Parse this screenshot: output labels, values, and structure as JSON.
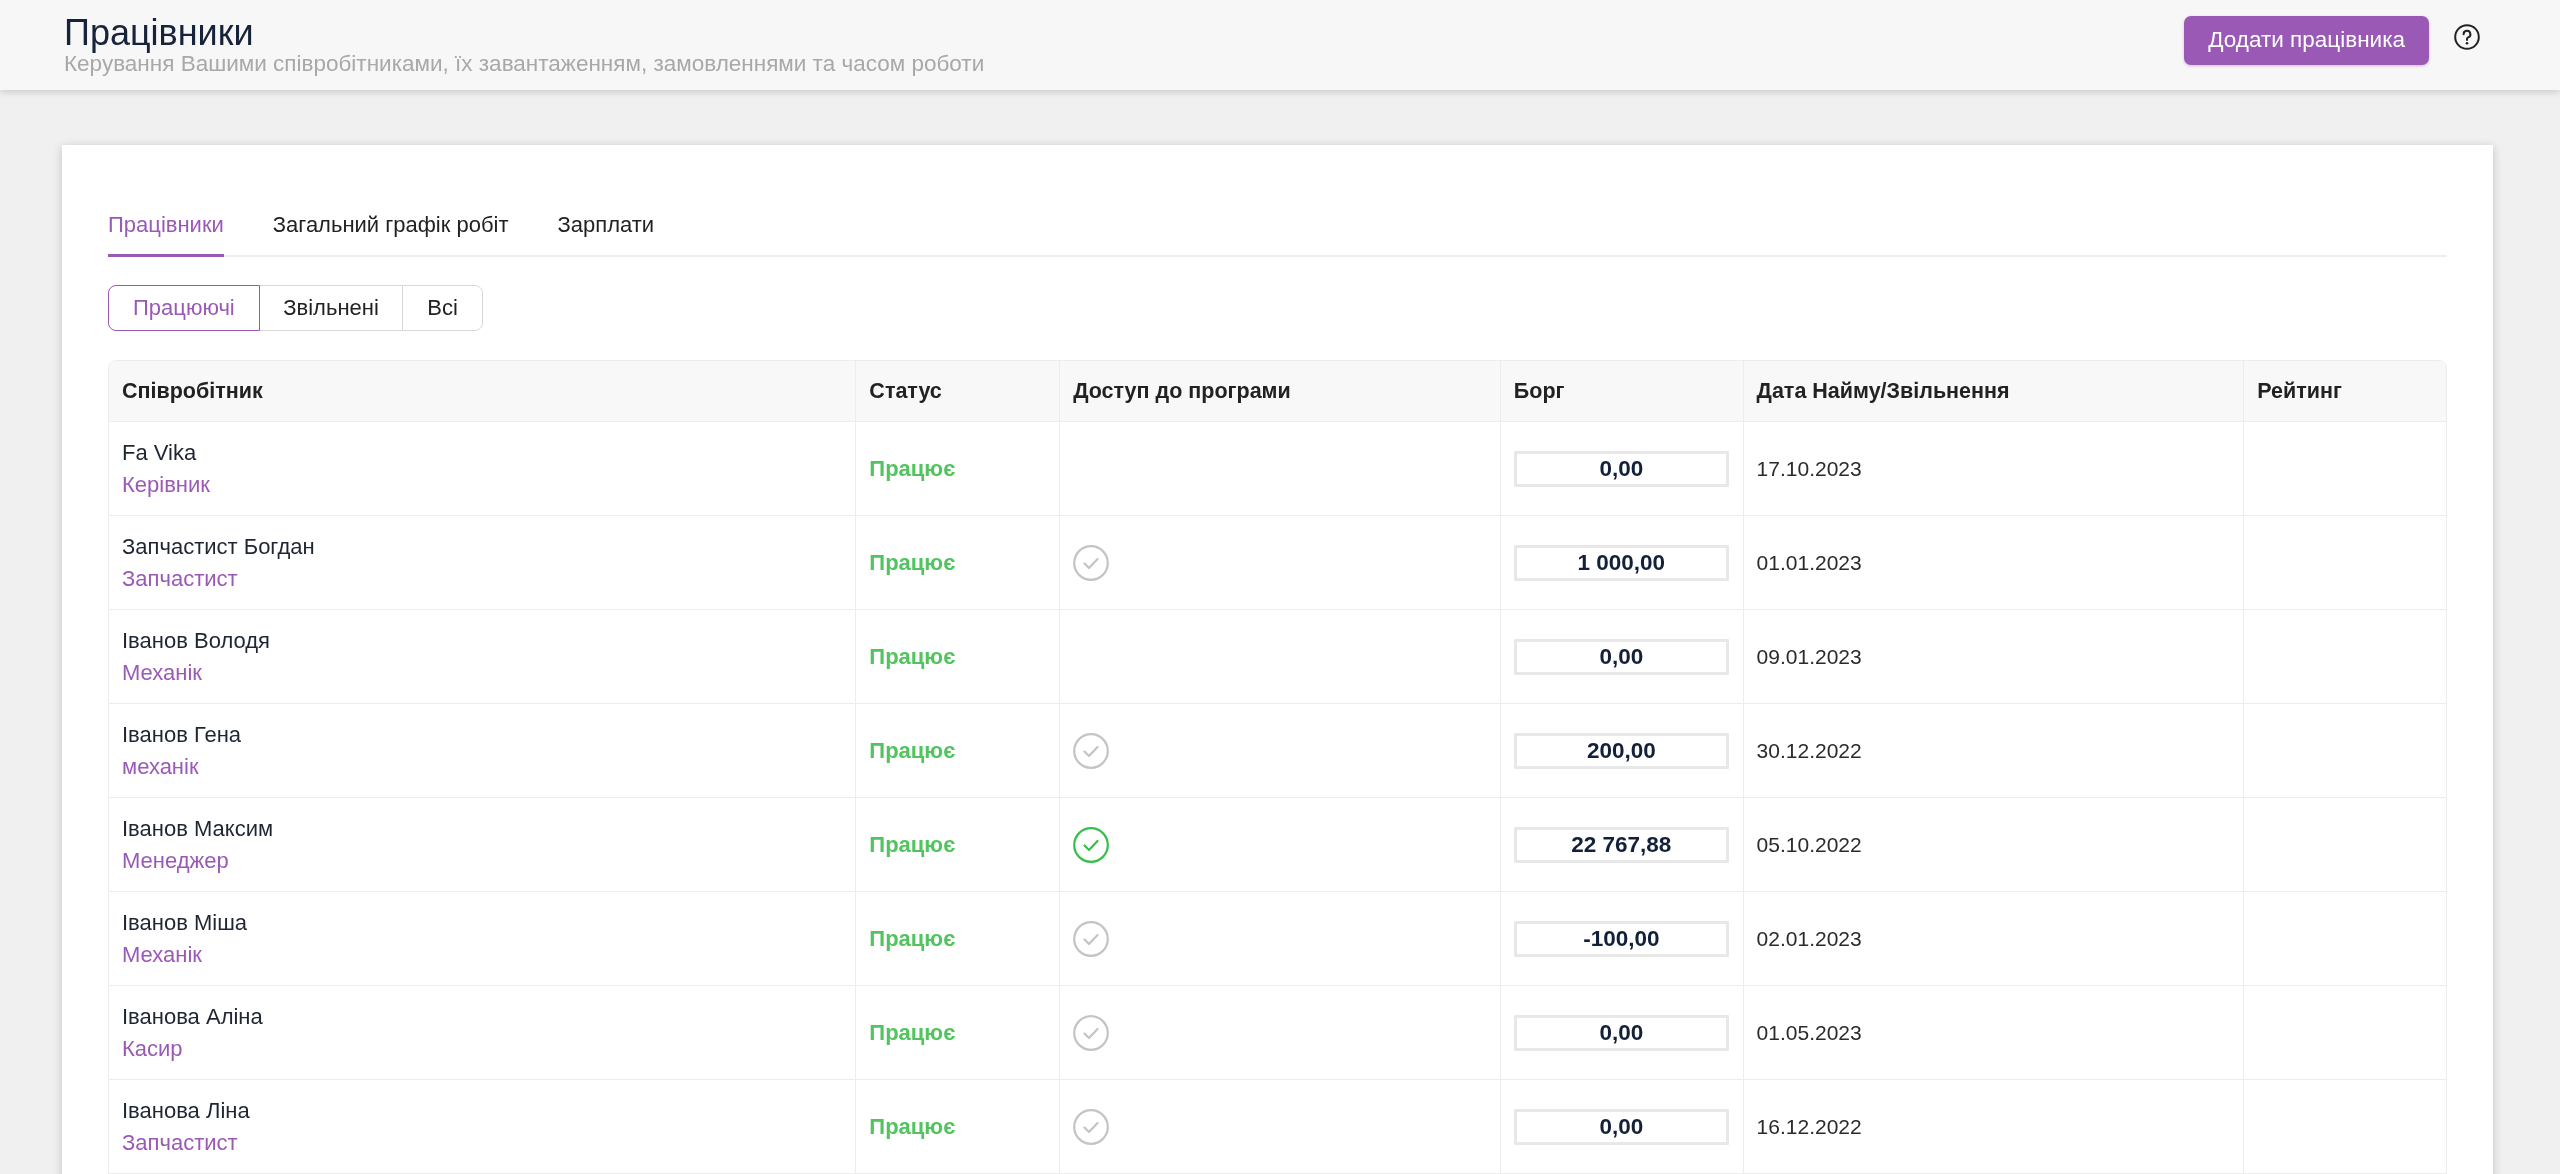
{
  "header": {
    "title": "Працівники",
    "subtitle": "Керування Вашими співробітниками, їх завантаженням, замовленнями та часом роботи",
    "add_button": "Додати працівника"
  },
  "tabs": [
    {
      "label": "Працівники",
      "selected": true
    },
    {
      "label": "Загальний графік робіт",
      "selected": false
    },
    {
      "label": "Зарплати",
      "selected": false
    }
  ],
  "filters": [
    {
      "label": "Працюючі",
      "selected": true
    },
    {
      "label": "Звільнені",
      "selected": false
    },
    {
      "label": "Всі",
      "selected": false
    }
  ],
  "table": {
    "columns": [
      "Співробітник",
      "Статус",
      "Доступ до програми",
      "Борг",
      "Дата Найму/Звільнення",
      "Рейтинг"
    ],
    "rows": [
      {
        "name": "Fa Vika",
        "role": "Керівник",
        "status": "Працює",
        "access_granted": false,
        "access_active": false,
        "debt": "0,00",
        "date": "17.10.2023"
      },
      {
        "name": "Запчастист Богдан",
        "role": "Запчастист",
        "status": "Працює",
        "access_granted": true,
        "access_active": false,
        "debt": "1 000,00",
        "date": "01.01.2023"
      },
      {
        "name": "Іванов Володя",
        "role": "Механік",
        "status": "Працює",
        "access_granted": false,
        "access_active": false,
        "debt": "0,00",
        "date": "09.01.2023"
      },
      {
        "name": "Іванов Гена",
        "role": "механік",
        "status": "Працює",
        "access_granted": true,
        "access_active": false,
        "debt": "200,00",
        "date": "30.12.2022"
      },
      {
        "name": "Іванов Максим",
        "role": "Менеджер",
        "status": "Працює",
        "access_granted": true,
        "access_active": true,
        "debt": "22 767,88",
        "date": "05.10.2022"
      },
      {
        "name": "Іванов Міша",
        "role": "Механік",
        "status": "Працює",
        "access_granted": true,
        "access_active": false,
        "debt": "-100,00",
        "date": "02.01.2023"
      },
      {
        "name": "Іванова Аліна",
        "role": "Касир",
        "status": "Працює",
        "access_granted": true,
        "access_active": false,
        "debt": "0,00",
        "date": "01.05.2023"
      },
      {
        "name": "Іванова Ліна",
        "role": "Запчастист",
        "status": "Працює",
        "access_granted": true,
        "access_active": false,
        "debt": "0,00",
        "date": "16.12.2022"
      }
    ]
  }
}
